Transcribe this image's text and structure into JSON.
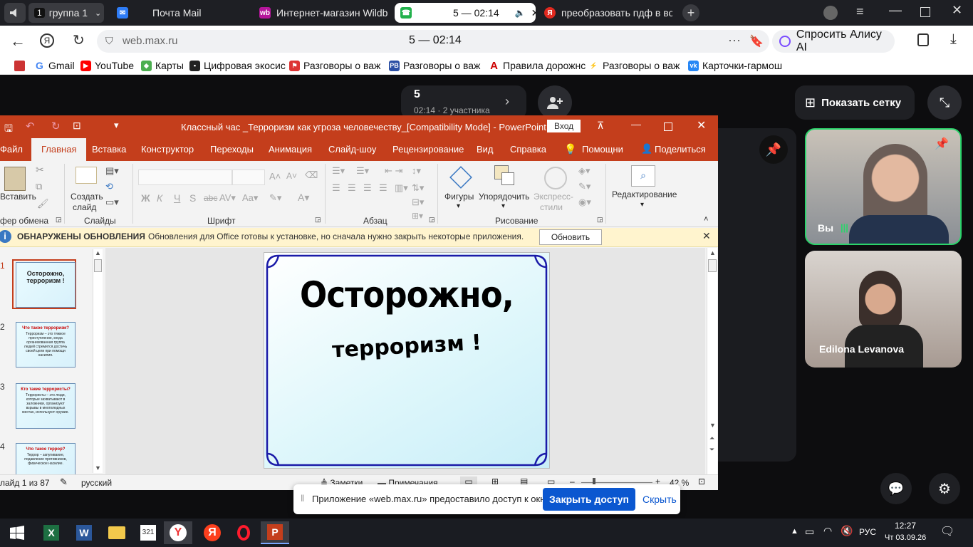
{
  "browser": {
    "tabs": [
      {
        "label": "группа 1",
        "badge": "1",
        "icon": "group-icon"
      },
      {
        "label": "Почта Mail",
        "icon": "mail-icon"
      },
      {
        "label": "Интернет-магазин Wildberries",
        "icon": "wildberries-icon"
      },
      {
        "label": "5 — 02:14",
        "icon": "phone-icon",
        "active": true
      },
      {
        "label": "преобразовать пдф в вор",
        "icon": "yandex-icon"
      }
    ],
    "address": "web.max.ru",
    "page_title": "5 — 02:14",
    "alice_label": "Спросить Алису AI",
    "bookmarks": [
      "Gmail",
      "YouTube",
      "Карты",
      "Цифровая экосис",
      "Разговоры о важ",
      "Разговоры о важ",
      "Правила дорожнс",
      "Разговоры о важ",
      "Карточки-гармош"
    ]
  },
  "call": {
    "count": "5",
    "info": "02:14 · 2 участника",
    "show_grid": "Показать сетку",
    "participants": [
      {
        "name": "Вы"
      },
      {
        "name": "Edilona Levanova"
      }
    ]
  },
  "ppt": {
    "title": "Классный час _Терроризм как угроза человечеству_[Compatibility Mode]  -  PowerPoint",
    "signin": "Вход",
    "tabs": [
      "Файл",
      "Главная",
      "Вставка",
      "Конструктор",
      "Переходы",
      "Анимация",
      "Слайд-шоу",
      "Рецензирование",
      "Вид",
      "Справка",
      "Помощни",
      "Поделиться"
    ],
    "ribbon": {
      "paste": "Вставить",
      "clipboard": "фер обмена",
      "create_slide_1": "Создать",
      "create_slide_2": "слайд",
      "slides": "Слайды",
      "font": "Шрифт",
      "paragraph": "Абзац",
      "shapes": "Фигуры",
      "arrange": "Упорядочить",
      "express_1": "Экспресс-",
      "express_2": "стили",
      "drawing": "Рисование",
      "editing": "Редактирование"
    },
    "info": {
      "title": "ОБНАРУЖЕНЫ ОБНОВЛЕНИЯ",
      "text": "Обновления для Office готовы к установке, но сначала нужно закрыть некоторые приложения.",
      "button": "Обновить"
    },
    "slides": [
      {
        "num": "1",
        "title": "Осторожно, терроризм !"
      },
      {
        "num": "2",
        "title": "Что такое терроризм?",
        "body": "Терроризм – это тяжкое преступление, когда организованная группа людей стремится достичь своей цели при помощи насилия."
      },
      {
        "num": "3",
        "title": "Кто такие террористы?",
        "body": "Террористы – это люди, которые захватывают в заложники, организуют взрывы в многолюдных местах, используют оружие."
      },
      {
        "num": "4",
        "title": "Что такое террор?",
        "body": "Террор – запугивание, подавление противников, физическое насилие."
      }
    ],
    "main_slide": {
      "line1": "Осторожно,",
      "line2": "терроризм !"
    },
    "status": {
      "slide": "лайд 1 из 87",
      "lang": "русский",
      "notes": "Заметки",
      "comments": "Примечания",
      "zoom": "42 %"
    }
  },
  "share": {
    "text": "Приложение «web.max.ru» предоставило доступ к окну.",
    "close": "Закрыть доступ",
    "hide": "Скрыть"
  },
  "taskbar": {
    "lang": "РУС",
    "time": "12:27",
    "date": "Чт 03.09.26"
  }
}
